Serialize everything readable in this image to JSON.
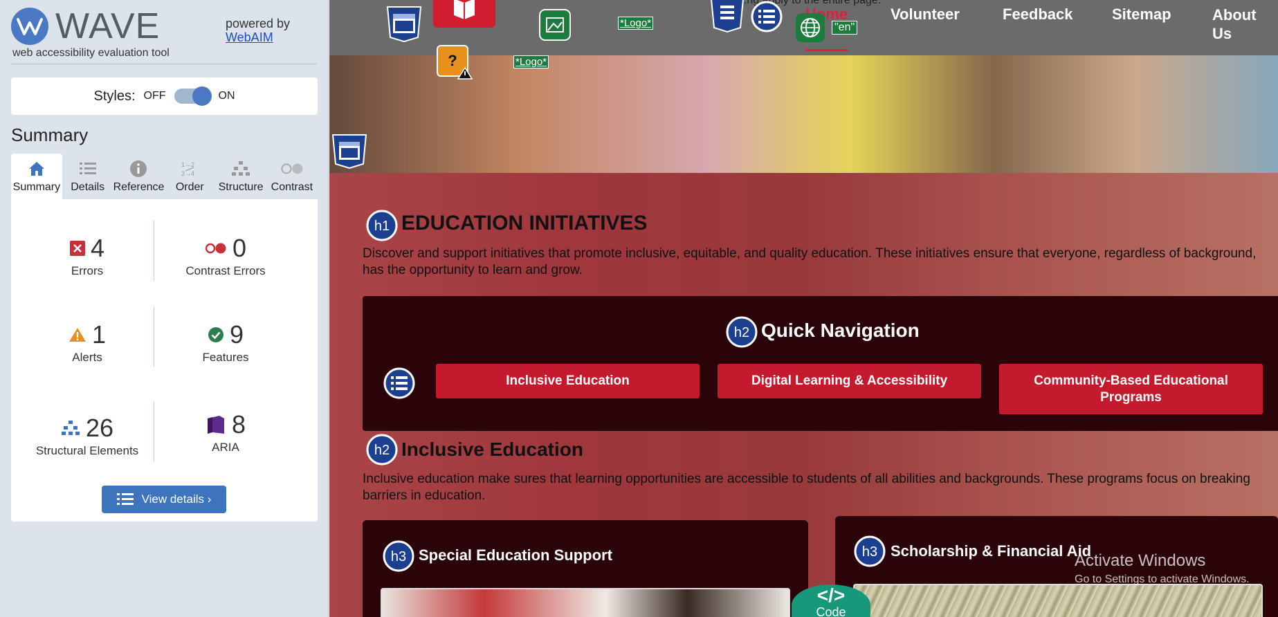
{
  "sidebar": {
    "logo_word": "WAVE",
    "tagline": "web accessibility evaluation tool",
    "powered_by": "powered by",
    "webaim_link": "WebAIM",
    "styles_label": "Styles:",
    "styles_off": "OFF",
    "styles_on": "ON",
    "summary_title": "Summary",
    "tabs": [
      {
        "label": "Summary",
        "icon": "home-icon",
        "active": true
      },
      {
        "label": "Details",
        "icon": "list-icon"
      },
      {
        "label": "Reference",
        "icon": "info-icon"
      },
      {
        "label": "Order",
        "icon": "order-icon"
      },
      {
        "label": "Structure",
        "icon": "structure-icon"
      },
      {
        "label": "Contrast",
        "icon": "contrast-icon"
      }
    ],
    "stats": {
      "errors": {
        "count": "4",
        "label": "Errors"
      },
      "contrast_errors": {
        "count": "0",
        "label": "Contrast Errors"
      },
      "alerts": {
        "count": "1",
        "label": "Alerts"
      },
      "features": {
        "count": "9",
        "label": "Features"
      },
      "structural": {
        "count": "26",
        "label": "Structural Elements"
      },
      "aria": {
        "count": "8",
        "label": "ARIA"
      }
    },
    "view_details": "View details ›"
  },
  "page": {
    "top_text": "...ng apply to the entire page.",
    "nav": {
      "home": "Home",
      "volunteer": "Volunteer",
      "feedback": "Feedback",
      "sitemap": "Sitemap",
      "about": "About Us"
    },
    "logo_badge_1": "*Logo*",
    "logo_badge_2": "*Logo*",
    "lang_badge": "\"en\"",
    "h1": "EDUCATION INITIATIVES",
    "intro": "Discover and support initiatives that promote inclusive, equitable, and quality education. These initiatives ensure that everyone, regardless of background, has the opportunity to learn and grow.",
    "quick_nav_title": "Quick Navigation",
    "quick_nav_buttons": [
      "Inclusive Education",
      "Digital Learning & Accessibility",
      "Community-Based Educational Programs"
    ],
    "h2_inclusive": "Inclusive Education",
    "inclusive_text": "Inclusive education make sures that learning opportunities are accessible to students of all abilities and backgrounds. These programs focus on breaking barriers in education.",
    "card1_title": "Special Education Support",
    "card2_title": "Scholarship & Financial Aid",
    "heading_badges": {
      "h1": "h1",
      "h2": "h2",
      "h3": "h3"
    },
    "activate_title": "Activate Windows",
    "activate_sub": "Go to Settings to activate Windows.",
    "code_symbol": "</>",
    "code_label": "Code"
  },
  "colors": {
    "wave_blue": "#4a78c2",
    "error_red": "#c8303a",
    "alert_orange": "#e8901c",
    "feature_green": "#2e7d4f",
    "aria_purple": "#5e2a8c",
    "brand_red": "#c41a2e",
    "dark_panel": "#2a0408"
  }
}
